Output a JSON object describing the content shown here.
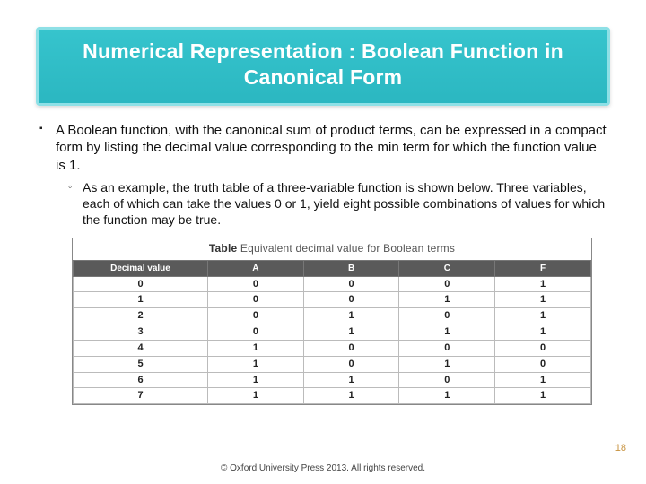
{
  "title": "Numerical Representation : Boolean Function in Canonical Form",
  "bullet1": "A Boolean function, with the canonical sum of product terms, can be expressed in a compact form by listing the decimal value corresponding to the min term for which the function value is 1.",
  "bullet2": "As an example, the truth table of a three-variable function is shown below. Three variables, each of which can take the values 0 or 1, yield eight possible combinations of values for which the function may be true.",
  "table": {
    "caption_bold": "Table",
    "caption_rest": " Equivalent decimal value for Boolean terms",
    "headers": [
      "Decimal value",
      "A",
      "B",
      "C",
      "F"
    ],
    "rows": [
      [
        "0",
        "0",
        "0",
        "0",
        "1"
      ],
      [
        "1",
        "0",
        "0",
        "1",
        "1"
      ],
      [
        "2",
        "0",
        "1",
        "0",
        "1"
      ],
      [
        "3",
        "0",
        "1",
        "1",
        "1"
      ],
      [
        "4",
        "1",
        "0",
        "0",
        "0"
      ],
      [
        "5",
        "1",
        "0",
        "1",
        "0"
      ],
      [
        "6",
        "1",
        "1",
        "0",
        "1"
      ],
      [
        "7",
        "1",
        "1",
        "1",
        "1"
      ]
    ]
  },
  "page_number": "18",
  "footer": "© Oxford University Press 2013. All rights reserved.",
  "chart_data": {
    "type": "table",
    "title": "Equivalent decimal value for Boolean terms",
    "columns": [
      "Decimal value",
      "A",
      "B",
      "C",
      "F"
    ],
    "rows": [
      [
        0,
        0,
        0,
        0,
        1
      ],
      [
        1,
        0,
        0,
        1,
        1
      ],
      [
        2,
        0,
        1,
        0,
        1
      ],
      [
        3,
        0,
        1,
        1,
        1
      ],
      [
        4,
        1,
        0,
        0,
        0
      ],
      [
        5,
        1,
        0,
        1,
        0
      ],
      [
        6,
        1,
        1,
        0,
        1
      ],
      [
        7,
        1,
        1,
        1,
        1
      ]
    ]
  }
}
